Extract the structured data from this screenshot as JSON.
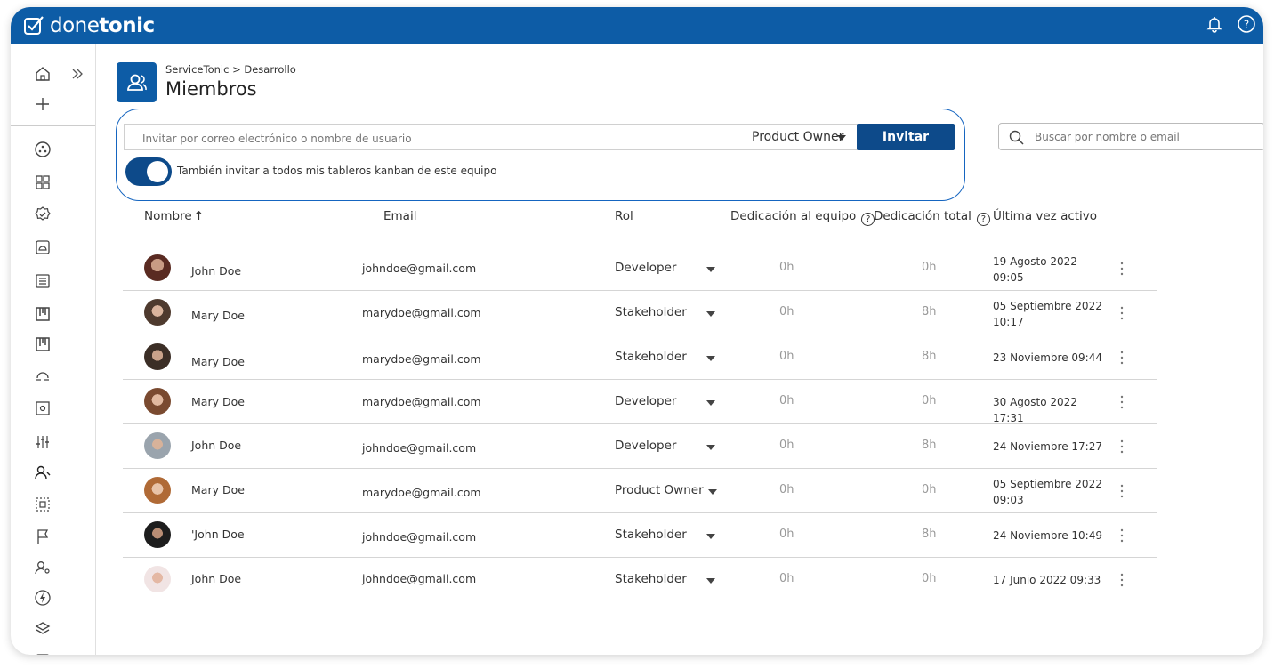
{
  "app": {
    "logo_light": "done",
    "logo_bold": "tonic"
  },
  "header": {
    "breadcrumb": "ServiceTonic > Desarrollo",
    "title": "Miembros"
  },
  "invite": {
    "placeholder": "Invitar por correo electrónico o nombre de usuario",
    "role_selected": "Product Owner",
    "button": "Invitar",
    "toggle_on": true,
    "toggle_label": "También invitar a todos mis tableros kanban de este equipo"
  },
  "search": {
    "placeholder": "Buscar por nombre o email"
  },
  "table": {
    "columns": {
      "name": "Nombre",
      "email": "Email",
      "role": "Rol",
      "dedication": "Dedicación al equipo",
      "total": "Dedicación total",
      "last": "Última vez activo"
    },
    "rows": [
      {
        "name": "John Doe",
        "email": "johndoe@gmail.com",
        "role": "Developer",
        "dedication": "0h",
        "total": "0h",
        "last1": "19 Agosto 2022",
        "last2": "09:05"
      },
      {
        "name": "Mary Doe",
        "email": "marydoe@gmail.com",
        "role": "Stakeholder",
        "dedication": "0h",
        "total": "8h",
        "last1": "05 Septiembre 2022",
        "last2": "10:17"
      },
      {
        "name": "Mary Doe",
        "email": "marydoe@gmail.com",
        "role": "Stakeholder",
        "dedication": "0h",
        "total": "8h",
        "last1": "23 Noviembre 09:44",
        "last2": ""
      },
      {
        "name": "Mary Doe",
        "email": "marydoe@gmail.com",
        "role": "Developer",
        "dedication": "0h",
        "total": "0h",
        "last1": "30 Agosto 2022 17:31",
        "last2": ""
      },
      {
        "name": "John Doe",
        "email": "johndoe@gmail.com",
        "role": "Developer",
        "dedication": "0h",
        "total": "8h",
        "last1": "24 Noviembre 17:27",
        "last2": ""
      },
      {
        "name": "Mary Doe",
        "email": "marydoe@gmail.com",
        "role": "Product Owner",
        "dedication": "0h",
        "total": "0h",
        "last1": "05 Septiembre 2022",
        "last2": "09:03"
      },
      {
        "name": "'John Doe",
        "email": "johndoe@gmail.com",
        "role": "Stakeholder",
        "dedication": "0h",
        "total": "8h",
        "last1": "24 Noviembre 10:49",
        "last2": ""
      },
      {
        "name": "John Doe",
        "email": "johndoe@gmail.com",
        "role": "Stakeholder",
        "dedication": "0h",
        "total": "0h",
        "last1": "17 Junio 2022 09:33",
        "last2": ""
      }
    ]
  },
  "colors": {
    "brand": "#0d5ca6",
    "button": "#0d4a8a"
  },
  "sidebar_icons": [
    "home-icon",
    "expand-icon",
    "add-icon",
    "integrations-icon",
    "apps-grid-icon",
    "check-badge-icon",
    "inbox-icon",
    "list-icon",
    "kanban-icon",
    "kanban-2-icon",
    "sync-icon",
    "settings-box-icon",
    "filters-icon",
    "members-icon",
    "select-area-icon",
    "flag-icon",
    "user-settings-icon",
    "automation-icon",
    "layers-icon",
    "more-icon"
  ]
}
